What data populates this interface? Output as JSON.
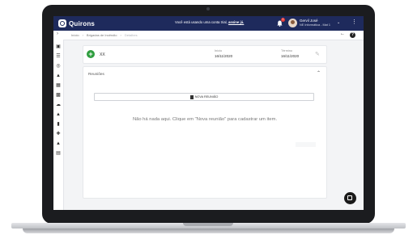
{
  "app": {
    "logo_text": "Quirons"
  },
  "topbar": {
    "trial_text": "Você está usando uma conta trial,",
    "trial_link": "assine já.",
    "notification_count": "1",
    "user_name": "Gervil José",
    "user_company": "NE Informática - Mat 1"
  },
  "breadcrumb": {
    "items": [
      "Início",
      "Brigadas de Incêndio",
      "Detalhes"
    ]
  },
  "sidebar": {
    "icons": [
      "monitor-icon",
      "list-icon",
      "target-icon",
      "hard-hat-icon",
      "sitemap-icon",
      "network-icon",
      "cloud-icon",
      "warning-icon",
      "fire-extinguisher-icon",
      "medical-icon",
      "fire-icon",
      "id-card-icon"
    ]
  },
  "summary": {
    "name": "XX",
    "start_label": "Início",
    "start_value": "16/11/2020",
    "end_label": "Término",
    "end_value": "16/11/2020"
  },
  "meetings": {
    "title": "Reuniões",
    "new_button": "NOVA REUNIÃO",
    "empty_message": "Não há nada aqui. Clique em \"Nova reunião\" para cadastrar um item."
  }
}
